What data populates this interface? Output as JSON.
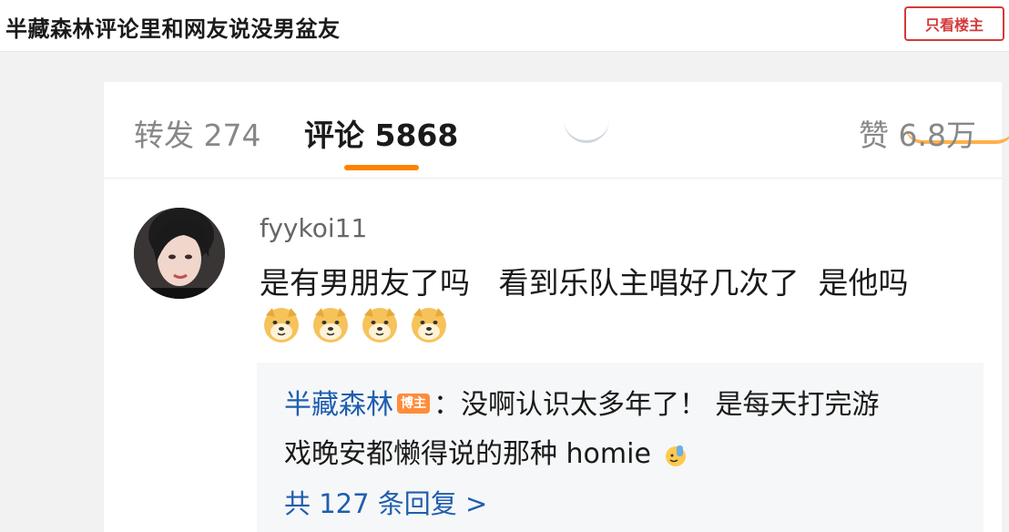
{
  "header": {
    "title": "半藏森林评论里和网友说没男盆友",
    "op_only_label": "只看楼主"
  },
  "tabs": [
    {
      "label": "转发",
      "count": "274"
    },
    {
      "label": "评论",
      "count": "5868"
    },
    {
      "label": "赞",
      "count": "6.8万"
    }
  ],
  "colors": {
    "accent": "#ff8200",
    "link": "#1f5eaf",
    "op_button": "#d43a3a",
    "badge": "#ff8c3a"
  },
  "comment": {
    "username": "fyykoi11",
    "text": "是有男朋友了吗   看到乐队主唱好几次了  是他吗",
    "emojis": [
      "doge-emoji",
      "doge-emoji",
      "doge-emoji",
      "doge-emoji"
    ]
  },
  "reply": {
    "author": "半藏森林",
    "badge": "博主",
    "separator": "：",
    "text_line1": "没啊认识太多年了！ 是每天打完游",
    "text_line2": "戏晚安都懒得说的那种 homie",
    "trailing_icon": "wave-hand-emoji",
    "more_replies": "共 127 条回复 >"
  }
}
